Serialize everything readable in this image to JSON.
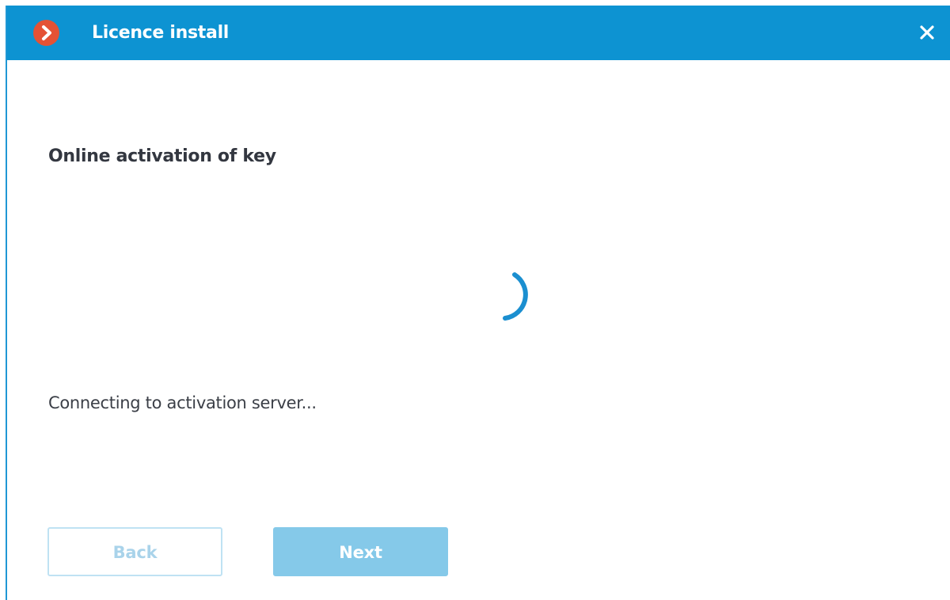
{
  "window": {
    "title": "Licence install"
  },
  "content": {
    "heading": "Online activation of key",
    "status": "Connecting to activation server..."
  },
  "buttons": {
    "back_label": "Back",
    "next_label": "Next"
  },
  "icons": {
    "logo": "app-logo-icon",
    "close": "close-icon",
    "spinner": "loading-spinner-icon"
  },
  "colors": {
    "titlebar": "#0d93d2",
    "logo": "#e45235",
    "spinner": "#1b8fd0",
    "next_button": "#85c9e9",
    "back_button_border": "#bfe2f3"
  }
}
